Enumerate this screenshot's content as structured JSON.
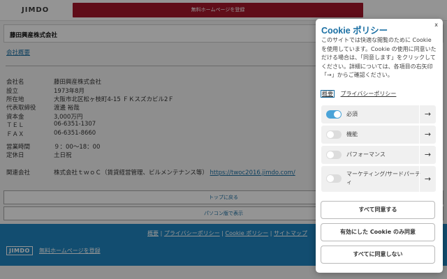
{
  "jimdo_bar": {
    "logo": "JIMDO",
    "cta": "無料ホームページを登録"
  },
  "company": {
    "name": "藤田興産株式会社",
    "section_link": "会社概要",
    "info": [
      {
        "label": "会社名",
        "value": "藤田興産株式会社"
      },
      {
        "label": "設立",
        "value": "1973年8月"
      },
      {
        "label": "所在地",
        "value": "大阪市北区松ヶ枝町4-15 ＦＫスズカビル2Ｆ"
      },
      {
        "label": "代表取締役",
        "value": "渡邊 裕哉"
      },
      {
        "label": "資本金",
        "value": "3,000万円"
      },
      {
        "label": "ＴＥＬ",
        "value": "06-6351-1307"
      },
      {
        "label": "ＦＡＸ",
        "value": "06-6351-8660"
      },
      {
        "label": "営業時間",
        "value": "９：00〜18：00"
      },
      {
        "label": "定休日",
        "value": "土日祝"
      },
      {
        "label": "関連会社",
        "value": "株式会社ｔｗｏＣ（賃貸経営管理、ビルメンテナンス等）",
        "link": "https://twoc2016.jimdo.com/"
      }
    ]
  },
  "nav": {
    "top": "トップに戻る",
    "pc": "パソコン版で表示"
  },
  "footer": {
    "links": [
      "概要",
      "プライバシーポリシー",
      "Cookie ポリシー",
      "サイトマップ"
    ],
    "separator": "|",
    "logo": "JIMDO",
    "cta": "無料ホームページを登録"
  },
  "cookie": {
    "close": "x",
    "title": "Cookie ポリシー",
    "body": "このサイトでは快適な閲覧のために Cookie を使用しています。Cookie の使用に同意いただける場合は、「同意します」をクリックしてください。詳細については、各項目の右矢印「→」からご確認ください。",
    "tab_overview": "概要",
    "tab_privacy": "プライバシーポリシー",
    "categories": [
      {
        "label": "必須",
        "enabled": true
      },
      {
        "label": "機能",
        "enabled": false
      },
      {
        "label": "パフォーマンス",
        "enabled": false
      },
      {
        "label": "マーケティング/サードパーティ",
        "enabled": false
      }
    ],
    "arrow": "→",
    "accept_all": "すべて同意する",
    "accept_selected": "有効にした Cookie のみ同意",
    "reject_all": "すべてに同意しない"
  },
  "colors": {
    "accent": "#1a6fa3",
    "cta_red": "#a5172c",
    "footer_blue": "#1f86c2",
    "toggle_on": "#4aa3d8"
  }
}
